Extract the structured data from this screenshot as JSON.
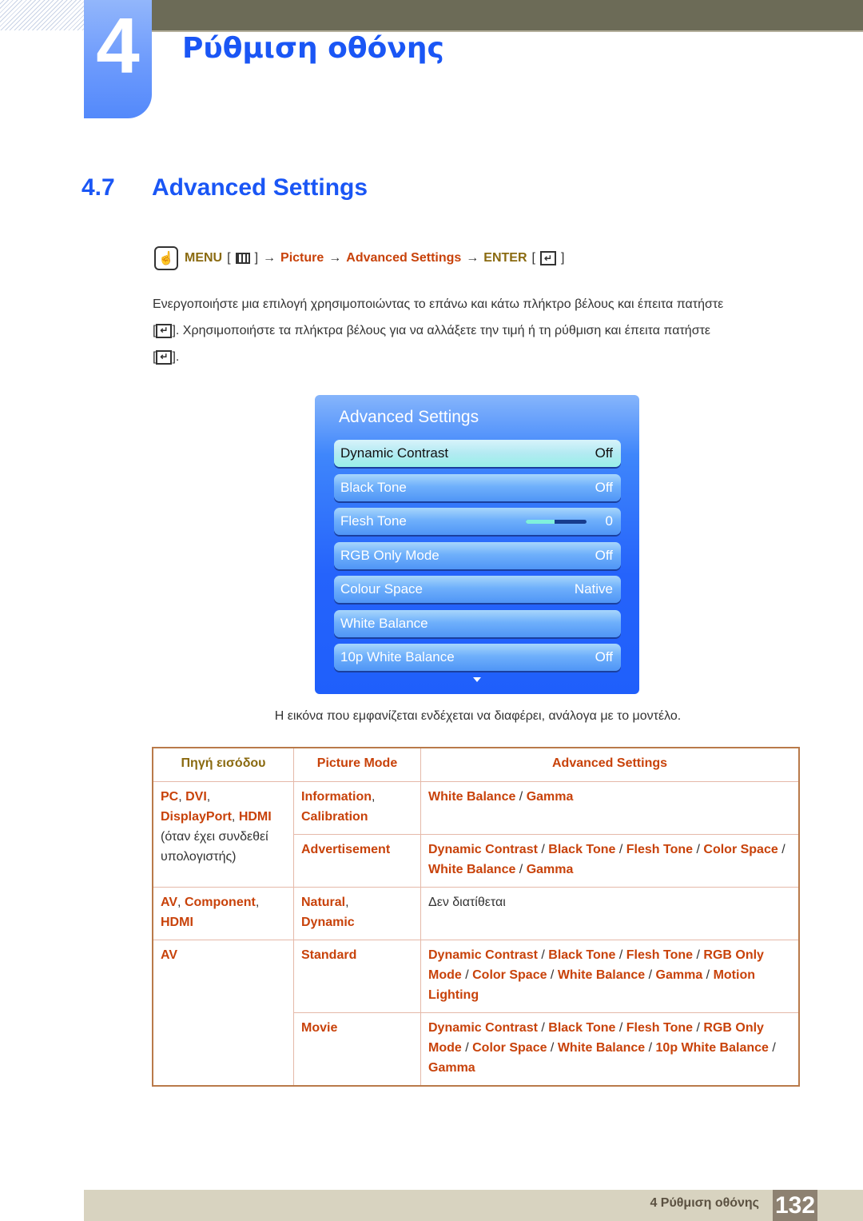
{
  "chapter": {
    "number": "4",
    "title": "Ρύθμιση οθόνης"
  },
  "section": {
    "number": "4.7",
    "title": "Advanced Settings"
  },
  "menu_path": {
    "menu": "MENU",
    "picture": "Picture",
    "advanced": "Advanced Settings",
    "enter": "ENTER",
    "arrow": "→",
    "open_bracket": "[",
    "close_bracket": "]"
  },
  "body": {
    "line1": "Ενεργοποιήστε μια επιλογή χρησιμοποιώντας το επάνω και κάτω πλήκτρο βέλους και έπειτα πατήστε",
    "line2": ". Χρησιμοποιήστε τα πλήκτρα βέλους για να αλλάξετε την τιμή ή τη ρύθμιση και έπειτα πατήστε",
    "line3": "."
  },
  "osd": {
    "title": "Advanced Settings",
    "items": [
      {
        "label": "Dynamic Contrast",
        "value": "Off",
        "selected": true
      },
      {
        "label": "Black Tone",
        "value": "Off"
      },
      {
        "label": "Flesh Tone",
        "value": "0",
        "slider_fraction": 0.48
      },
      {
        "label": "RGB Only Mode",
        "value": "Off"
      },
      {
        "label": "Colour Space",
        "value": "Native"
      },
      {
        "label": "White Balance",
        "value": ""
      },
      {
        "label": "10p White Balance",
        "value": "Off"
      }
    ]
  },
  "caption": "Η εικόνα που εμφανίζεται ενδέχεται να διαφέρει, ανάλογα με το μοντέλο.",
  "table": {
    "headers": [
      "Πηγή εισόδου",
      "Picture Mode",
      "Advanced Settings"
    ],
    "rows": {
      "pc_source": {
        "a": "PC",
        "b": "DVI",
        "c": "DisplayPort",
        "d": "HDMI",
        "note": "(όταν έχει συνδεθεί υπολογιστής)"
      },
      "info_mode": {
        "a": "Information",
        "b": "Calibration"
      },
      "info_settings": [
        "White Balance",
        "Gamma"
      ],
      "adv_mode": "Advertisement",
      "adv_settings": [
        "Dynamic Contrast",
        "Black Tone",
        "Flesh Tone",
        "Color Space",
        "White Balance",
        "Gamma"
      ],
      "av_source": {
        "a": "AV",
        "b": "Component",
        "c": "HDMI"
      },
      "natural_mode": {
        "a": "Natural",
        "b": "Dynamic"
      },
      "natural_settings": "Δεν διατίθεται",
      "av2_source": "AV",
      "standard_mode": "Standard",
      "standard_settings": [
        "Dynamic Contrast",
        "Black Tone",
        "Flesh Tone",
        "RGB Only Mode",
        "Color Space",
        "White Balance",
        "Gamma",
        "Motion Lighting"
      ],
      "movie_mode": "Movie",
      "movie_settings": [
        "Dynamic Contrast",
        "Black Tone",
        "Flesh Tone",
        "RGB Only Mode",
        "Color Space",
        "White Balance",
        "10p White Balance",
        "Gamma"
      ]
    }
  },
  "footer": {
    "text": "4 Ρύθμιση οθόνης",
    "page": "132"
  }
}
